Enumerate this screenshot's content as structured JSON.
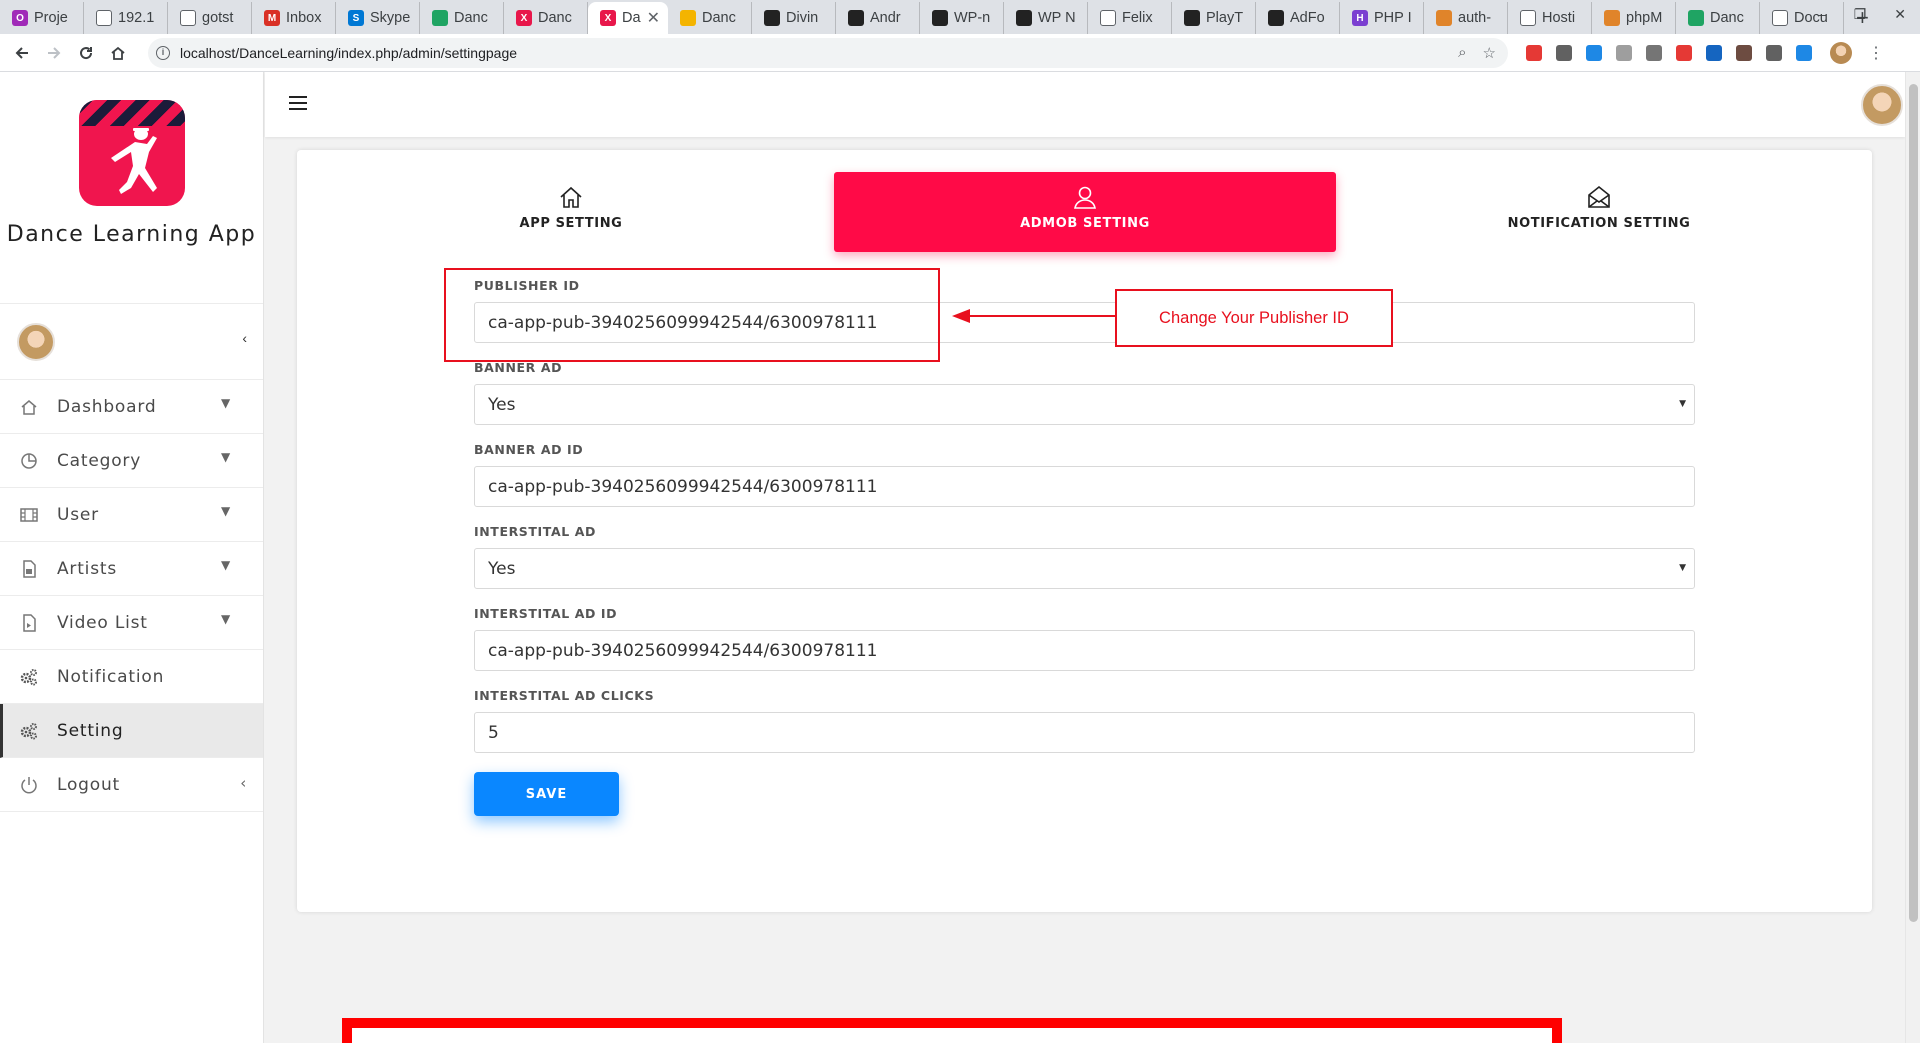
{
  "browser": {
    "tabs": [
      {
        "title": "Proje",
        "fav_color": "#a02ab8",
        "fav_text": "O"
      },
      {
        "title": "192.1",
        "fav_color": "#ffffff",
        "fav_text": ""
      },
      {
        "title": "gotst",
        "fav_color": "#ffffff",
        "fav_text": ""
      },
      {
        "title": "Inbox",
        "fav_color": "#d93025",
        "fav_text": "M"
      },
      {
        "title": "Skype",
        "fav_color": "#0078d4",
        "fav_text": "S"
      },
      {
        "title": "Danc",
        "fav_color": "#1fa463",
        "fav_text": ""
      },
      {
        "title": "Danc",
        "fav_color": "#e8174b",
        "fav_text": "X"
      },
      {
        "title": "Da",
        "fav_color": "#e8174b",
        "fav_text": "X",
        "active": true
      },
      {
        "title": "Danc",
        "fav_color": "#f4b400",
        "fav_text": ""
      },
      {
        "title": "Divin",
        "fav_color": "#222222",
        "fav_text": ""
      },
      {
        "title": "Andr",
        "fav_color": "#222222",
        "fav_text": ""
      },
      {
        "title": "WP-n",
        "fav_color": "#222222",
        "fav_text": ""
      },
      {
        "title": "WP N",
        "fav_color": "#222222",
        "fav_text": ""
      },
      {
        "title": "Felix",
        "fav_color": "#ffffff",
        "fav_text": ""
      },
      {
        "title": "PlayT",
        "fav_color": "#222222",
        "fav_text": ""
      },
      {
        "title": "AdFo",
        "fav_color": "#222222",
        "fav_text": ""
      },
      {
        "title": "PHP I",
        "fav_color": "#7b3fd1",
        "fav_text": "H"
      },
      {
        "title": "auth-",
        "fav_color": "#e0842a",
        "fav_text": ""
      },
      {
        "title": "Hosti",
        "fav_color": "#ffffff",
        "fav_text": ""
      },
      {
        "title": "phpM",
        "fav_color": "#e0842a",
        "fav_text": ""
      },
      {
        "title": "Danc",
        "fav_color": "#1fa463",
        "fav_text": ""
      },
      {
        "title": "Docu",
        "fav_color": "#ffffff",
        "fav_text": ""
      }
    ],
    "active_tab_close": "✕",
    "new_tab": "+",
    "url": "localhost/DanceLearning/index.php/admin/settingpage",
    "ext_colors": [
      "#e53935",
      "#616161",
      "#1e88e5",
      "#9e9e9e",
      "#757575",
      "#e53935",
      "#1565c0",
      "#6d4c41",
      "#616161",
      "#1e88e5"
    ]
  },
  "sidebar": {
    "brand_name": "Dance Learning App",
    "menu": [
      {
        "label": "Dashboard",
        "icon": "home-icon",
        "chevron": "▼"
      },
      {
        "label": "Category",
        "icon": "pie-chart-icon",
        "chevron": "▼"
      },
      {
        "label": "User",
        "icon": "film-icon",
        "chevron": "▼"
      },
      {
        "label": "Artists",
        "icon": "document-image-icon",
        "chevron": "▼"
      },
      {
        "label": "Video List",
        "icon": "video-file-icon",
        "chevron": "▼"
      },
      {
        "label": "Notification",
        "icon": "gears-icon",
        "chevron": ""
      },
      {
        "label": "Setting",
        "icon": "gears-icon",
        "chevron": "",
        "active": true
      },
      {
        "label": "Logout",
        "icon": "power-icon",
        "chevron": "‹"
      }
    ],
    "collapse_glyph": "‹"
  },
  "settings_tabs": [
    {
      "label": "APP SETTING",
      "icon": "home-icon"
    },
    {
      "label": "ADMOB SETTING",
      "icon": "user-icon",
      "active": true
    },
    {
      "label": "NOTIFICATION SETTING",
      "icon": "envelope-open-icon"
    }
  ],
  "form": {
    "publisher_id": {
      "label": "PUBLISHER ID",
      "value": "ca-app-pub-3940256099942544/6300978111"
    },
    "banner_ad": {
      "label": "BANNER AD",
      "value": "Yes"
    },
    "banner_ad_id": {
      "label": "BANNER AD ID",
      "value": "ca-app-pub-3940256099942544/6300978111"
    },
    "interstitial_ad": {
      "label": "INTERSTITAL AD",
      "value": "Yes"
    },
    "interstitial_ad_id": {
      "label": "INTERSTITAL AD ID",
      "value": "ca-app-pub-3940256099942544/6300978111"
    },
    "interstitial_ad_clicks": {
      "label": "INTERSTITAL AD CLICKS",
      "value": "5"
    },
    "save_label": "SAVE"
  },
  "annotation": {
    "text": "Change Your Publisher ID",
    "color": "#e8101e"
  },
  "colors": {
    "accent_pink": "#ff0a47",
    "save_blue": "#0a87ff"
  }
}
